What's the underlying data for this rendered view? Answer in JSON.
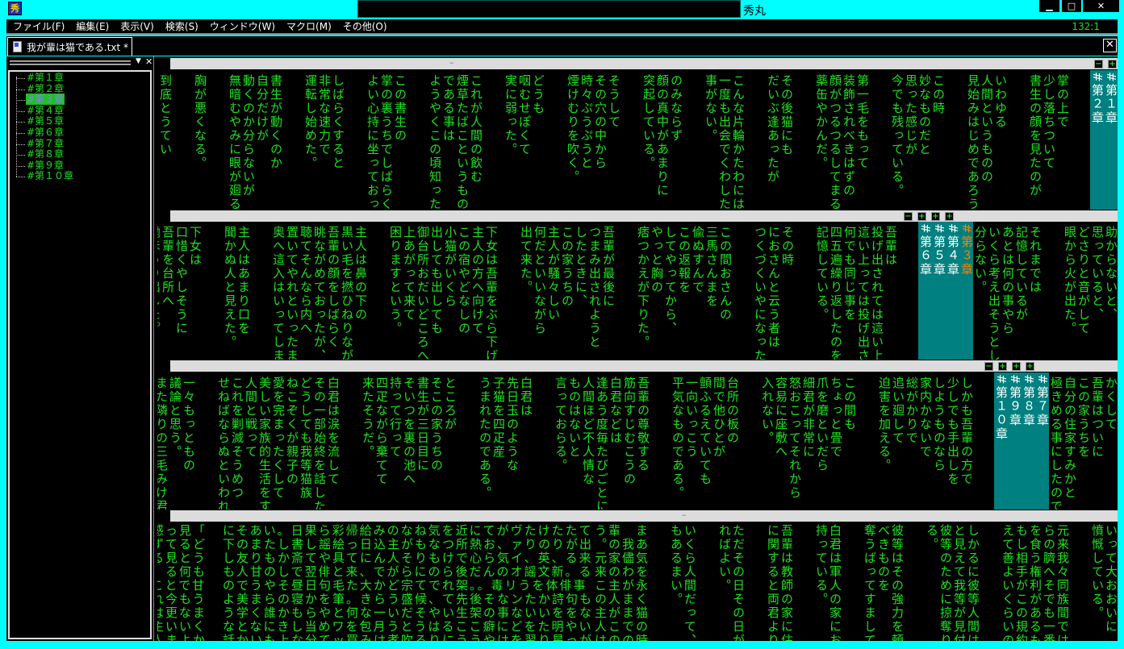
{
  "window": {
    "title": "秀丸",
    "minimize": "▁",
    "maximize": "□",
    "close": "✕"
  },
  "menu": [
    "ファイル(F)",
    "編集(E)",
    "表示(V)",
    "検索(S)",
    "ウィンドウ(W)",
    "マクロ(M)",
    "その他(O)"
  ],
  "cursor_position": "132:1",
  "tab": {
    "label": "我が輩は猫である.txt *",
    "close": "✕"
  },
  "outline": {
    "menu_icon": "▼",
    "close_icon": "✕",
    "items": [
      {
        "label": "#第１章"
      },
      {
        "label": "#第２章"
      },
      {
        "label": "#第３章",
        "selected": true
      },
      {
        "label": "#第４章"
      },
      {
        "label": "#第５章"
      },
      {
        "label": "#第６章"
      },
      {
        "label": "#第７章"
      },
      {
        "label": "#第８章"
      },
      {
        "label": "#第９章"
      },
      {
        "label": "#第１０章"
      }
    ]
  },
  "colors": {
    "text": "#20e020",
    "heading_bg": "#008080",
    "current_heading": "#ff8000",
    "frame": "#00ffff"
  },
  "panes": [
    {
      "buttons": [
        "−",
        "+"
      ],
      "divider": "–",
      "columns": [
        {
          "type": "heading",
          "items": [
            {
              "label": "#第１章"
            },
            {
              "label": "#第２章"
            }
          ]
        },
        "",
        "掌の上で",
        "少し落ちついて",
        "書生の顔を見たのが",
        "",
        "いわゆる",
        "人間というものの",
        "見始みはじめであろう。",
        "",
        "この時",
        "妙なものだと",
        "思った感じが",
        "今でも残っている。",
        "",
        "第一毛をもって",
        "装飾されべきはずの",
        "顔がつるつるしてまるで",
        "薬缶やかんだ。",
        "",
        "その後猫にも",
        "だいぶ逢あったが",
        "",
        "こんな片輪かたわには",
        "一度も出会でくわした",
        "事がない。",
        "",
        "のみならず",
        "顔の真中があまりに",
        "突起している。",
        "",
        "そうして",
        "その穴の中から",
        "時々ぷうぷうと",
        "煙けむりを吹く。",
        "",
        "どうも",
        "咽むせぽくて",
        "実に弱った。",
        "",
        "これが人間の飲む",
        "煙草たばこというもの",
        "である事は",
        "ようやくこの頃知った。",
        "",
        "この書生の",
        "掌の裏うちでしばらくは",
        "よい心持に坐っておったが",
        "",
        "しばらくすると",
        "非常な速力で",
        "運転し始めた。",
        "",
        "書生が動くのか",
        "自分だけが",
        "動くのか分らないが",
        "無暗むやみに眼が廻る。",
        "",
        "胸が悪くなる。",
        "",
        "到底とうてい"
      ]
    },
    {
      "buttons": [
        "−",
        "+",
        "+",
        "+"
      ],
      "columns": [
        "助からないと、",
        "思っていると、",
        "どさりと音がして",
        "眼から火が出た。",
        "",
        "それまでは",
        "記憶しているが",
        "あとは何の事やら",
        "いくら考え出そうとして",
        "分らない。",
        {
          "type": "heading",
          "items": [
            {
              "label": "#第３章",
              "current": true
            },
            {
              "label": "#第４章"
            },
            {
              "label": "#第５章"
            },
            {
              "label": "#第６章"
            }
          ]
        },
        "",
        "吾輩は",
        "投げ出されては這い上り",
        "這い上っては投げ出され",
        "何でも同じ事を",
        "四五遍繰り返したのを",
        "記憶している。",
        "",
        "その時",
        "におさんと云う者は",
        "つくづくいやになった。",
        "",
        "この間おさんの",
        "三馬さんまを",
        "偸ぬすんで",
        "この返報を",
        "してやってから、",
        "やっと胸の",
        "痞つかえが下りた。",
        "",
        "吾輩が最後に",
        "つまみ出されようと",
        "したときに、",
        "この家うちの",
        "主人が騒々しい",
        "何だといいながら",
        "出て来た。",
        "",
        "下女は吾輩をぶら下げて",
        "主人の方へ向けて",
        "この宿やどなしの",
        "小猫がいくら",
        "出しても出しても",
        "御台所おだいどころへ",
        "上あがって来て",
        "困りますという。",
        "",
        "主人は鼻の下の",
        "黒い毛を撚ひねりながら",
        "吾輩の顔をしばらく",
        "眺ながめておったが、",
        "聴てそんなら内へ",
        "置いてやれといったまま",
        "奥へ這入はいってしまった。",
        "",
        "主人はあまり口を",
        "聞かぬ人と見えた。",
        "",
        "下女は",
        "口惜くやしそうに",
        "吾輩を台所へ",
        "抛ほうり出した。"
      ]
    },
    {
      "buttons": [
        "−",
        "+",
        "+",
        "+"
      ],
      "columns": [
        "かくして",
        "吾輩はついに",
        "この家うちを",
        "自分の住家すみかと",
        "極きめる事にしたのであ",
        {
          "type": "heading",
          "items": [
            {
              "label": "#第７章"
            },
            {
              "label": "#第８章"
            },
            {
              "label": "#第９章"
            },
            {
              "label": "#第１０章"
            }
          ]
        },
        "",
        "しかも吾輩の方で",
        "少しでも手出しを",
        "しようものなら",
        "家内かないで",
        "総がかりで",
        "追い廻して",
        "迫害を加える。",
        "",
        "この間も",
        "ちょっと畳で",
        "爪を磨といだら",
        "細君が非常に",
        "怒おこってそれから",
        "容易に座敷へ",
        "入れない。",
        "",
        "台所の板の",
        "間で他ひとが",
        "顫ふるえていても",
        "一向いっこう",
        "平気なものである。",
        "",
        "吾輩の尊敬する",
        "筋向すじむこうの",
        "白君などは",
        "逢あう度毎たびごとに",
        "人間ほど不人情な",
        "ものはないと",
        "言っておらる。",
        "",
        "白君は",
        "先日玉のような",
        "子猫を四疋産",
        "うまれたのである。",
        "",
        "ところが",
        "そこの家うちの",
        "書生が三日目に",
        "そいつを裏の池へ",
        "持って行って",
        "四疋ながら棄てて",
        "来たそうだ。",
        "",
        "白君は涙を流して",
        "その一部始終を話した上",
        "どうしても我等猫族",
        "ねこぞくが親子の",
        "愛を完まったくして",
        "美しい家族的生活をする",
        "人間と戦って",
        "これを剿滅そうめつ",
        "せねばならぬといわれた",
        "",
        "一々もっともの",
        "議論と思う。",
        "また隣りの三毛みけ君な",
        "人間が所有権という",
        "事を解していないと"
      ]
    },
    {
      "divider": "–",
      "columns": [
        "いって大おおいに",
        "憤慨している。",
        "",
        "元来我々同族間では",
        "らの臍へそでも一番",
        "を食う権利があるも",
        "もし相手がこの規約",
        "えて善よいくらいの",
        "",
        "しかるに彼等人間は",
        "と見えて我等が見付",
        "彼等のために掠奪り",
        "る。",
        "",
        "彼等はその強力を頼",
        "べきものを",
        "奪うばってすまして",
        "",
        "白君は軍人の家にお",
        "持っている。",
        "",
        "吾輩は教師の家に住",
        "に関すると両君より",
        "",
        "ただその日その日が",
        "ればよい。",
        "",
        "いくら人間だって、",
        "もあるまい。",
        "",
        "まあ気を永く猫の時",
        "　我儘わがままでの思",
        "輩の家の主人がこの",
        "う。元来この主人は",
        {
          "type": "grid",
          "groups": [
            {
              "rows": [
                "にそあい。日果ら彩帰給みのなね気を近にてがヴたけたたて",
                "下のまたし書し謡絵っ日込主がもなつ所熱お、ァりのりが出",
                "し友りもか斎てや具てにん人そりもけで心ら気イ、英、る来",
                "も人甘のしで翌俳と来、でがらにのら後だんのオ謡文新。る",
                "のでうやそ昼日句毛た大かど宗てでれ架。。毒リうを体俳事",
                "よ美まらの寝かを筆。きらう盛候、て先後そなンたか詩句も",
                "う学く誰かもらやと何な一いだそやい生架の事ないいををな",
                "なとなにきし当めワを包月うとうはるここ癖にどをた明やい",
                "話かいも上な分てッ買みは孝吹ろりにううやはを習り星っが"
              ]
            },
            {
              "rows": [
                "金。感っ見「",
                "縁なずてるど",
                "のるる見とう",
                "眼ほ」る何も",
                "鏡どことで甘",
                "越詐れ今もう",
                "めいは更なま",
                "がつ主いいく",
                "ねわ人まよか"
              ]
            }
          ]
        }
      ]
    }
  ]
}
